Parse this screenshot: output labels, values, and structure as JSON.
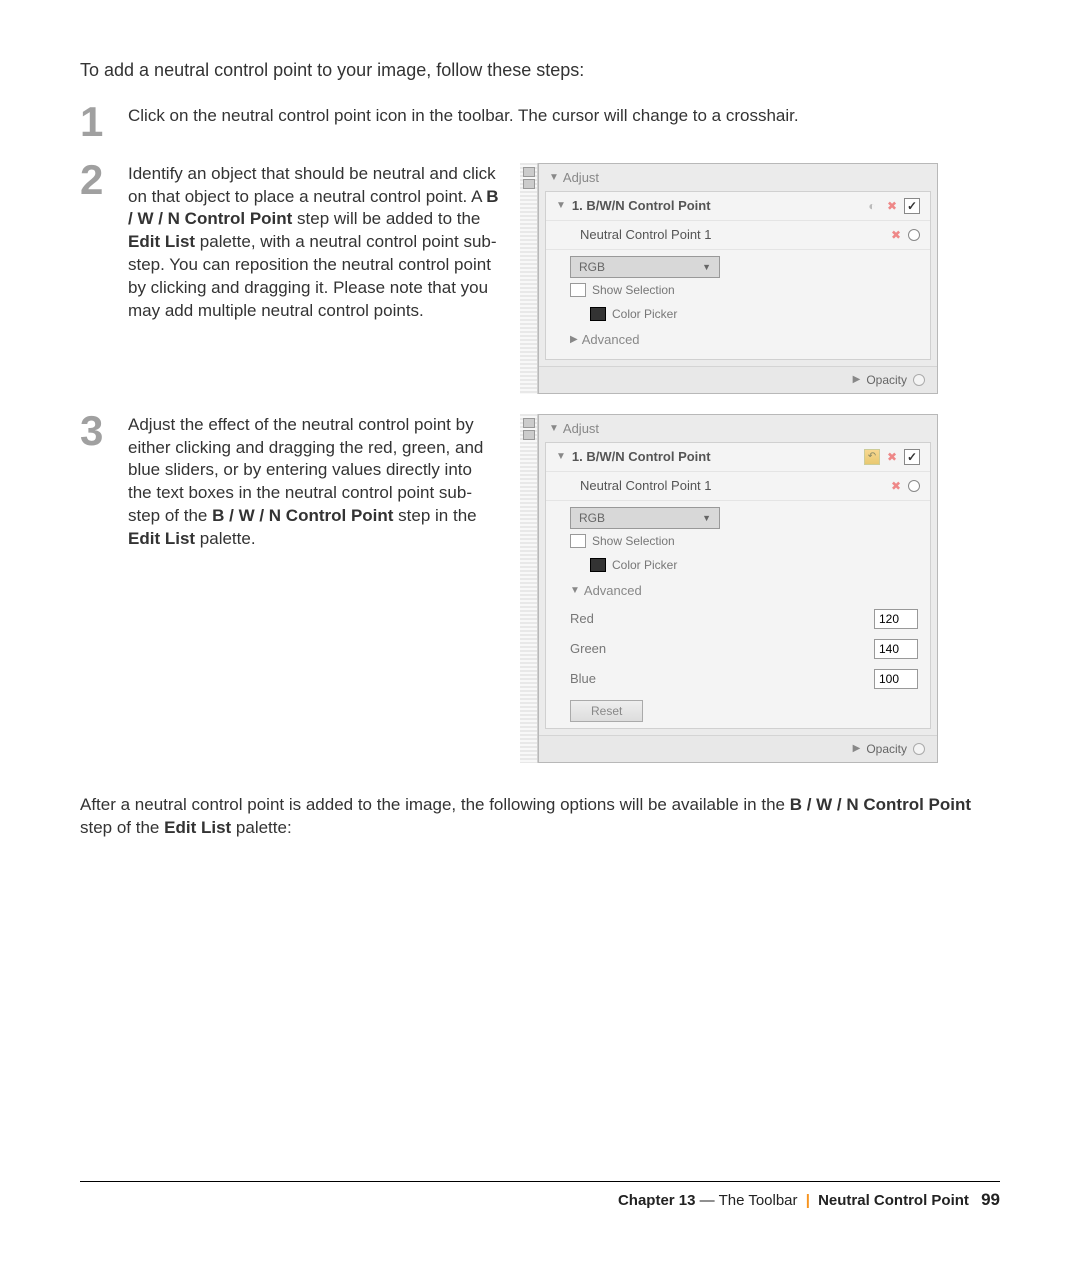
{
  "intro": "To add a neutral control point to your image, follow these steps:",
  "steps": {
    "s1": {
      "num": "1",
      "text_before": "Click on the neutral control point icon in the toolbar. The cursor will change to a crosshair."
    },
    "s2": {
      "num": "2",
      "text_a": "Identify an object that should be neutral and click on that object to place a neutral control point. A ",
      "bold1": "B / W / N Control Point",
      "text_b": " step will be added to the ",
      "bold2": "Edit List",
      "text_c": " palette, with a neutral control point sub-step. You can reposition the neutral control point by clicking and dragging it. Please note that you may add multiple neutral control points."
    },
    "s3": {
      "num": "3",
      "text_a": "Adjust the effect of the neutral control point by either clicking and dragging the red, green, and blue sliders, or by entering values directly into the text boxes in the neutral control point sub-step of the ",
      "bold1": "B / W / N Control Point",
      "text_b": " step in the ",
      "bold2": "Edit List",
      "text_c": " palette."
    }
  },
  "panel": {
    "adjust": "Adjust",
    "header": "1. B/W/N Control Point",
    "sub": "Neutral Control Point 1",
    "dropdown": "RGB",
    "show_sel": "Show Selection",
    "color_picker": "Color Picker",
    "advanced": "Advanced",
    "opacity": "Opacity",
    "red": "Red",
    "green": "Green",
    "blue": "Blue",
    "red_v": "120",
    "green_v": "140",
    "blue_v": "100",
    "reset": "Reset"
  },
  "after": {
    "a": "After a neutral control point is added to the image, the following options will be available in the ",
    "b1": "B / W / N Control Point",
    "b": " step of the ",
    "b2": "Edit List",
    "c": " palette:"
  },
  "footer": {
    "chapter": "Chapter 13",
    "dash": " — ",
    "title": "The Toolbar",
    "section": "Neutral Control Point",
    "page": "99"
  }
}
